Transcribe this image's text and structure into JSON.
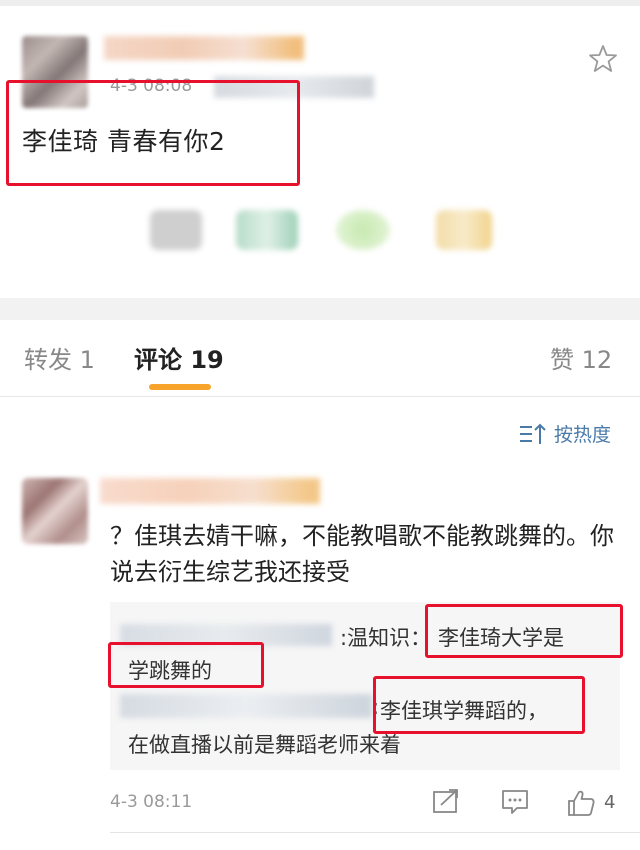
{
  "post": {
    "time": "4-3 08:08",
    "text": "李佳琦 青春有你2"
  },
  "tabs": {
    "repost": "转发 1",
    "comments": "评论 19",
    "likes": "赞 12"
  },
  "sort": {
    "label": "按热度"
  },
  "comment": {
    "text": "？佳琪去婧干嘛，不能教唱歌不能教跳舞的。你说去衍生综艺我还接受",
    "time": "4-3 08:11",
    "like_count": "4",
    "replies": [
      {
        "prefix": ":温知识：",
        "text": "李佳琦大学是",
        "text_cont": "学跳舞的"
      },
      {
        "prefix": ":",
        "text": "李佳琪学舞蹈的，",
        "text_cont": "在做直播以前是舞蹈老师来着"
      }
    ]
  },
  "colors": {
    "accent_underline": "#f7a32c",
    "link_blue": "#4a7aa8",
    "highlight_red": "#e8112d"
  }
}
